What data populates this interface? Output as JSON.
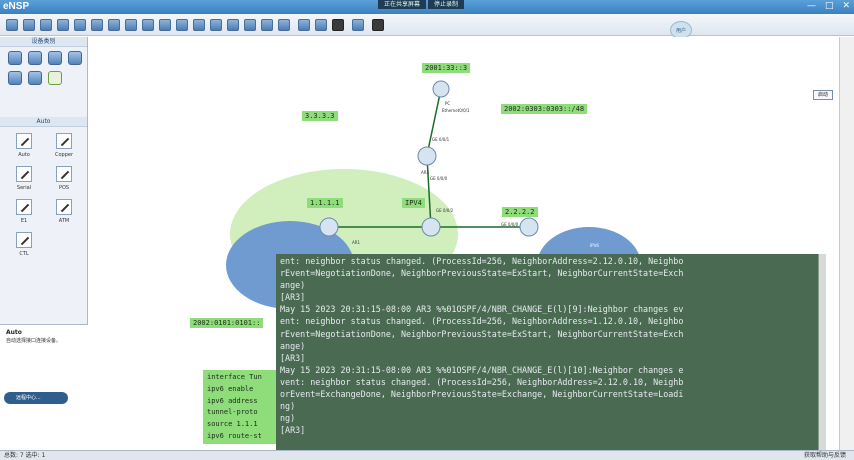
{
  "app": {
    "title": "eNSP",
    "window_controls": [
      "—",
      "□",
      "✕"
    ]
  },
  "recorder": {
    "items": [
      "正在共享屏幕",
      "停止录制"
    ]
  },
  "toolbar": {
    "user_label": "用户"
  },
  "left_panel": {
    "device_header": "设备类别",
    "cable_header": "Auto",
    "cables": [
      "Auto",
      "Copper",
      "Serial",
      "POS",
      "E1",
      "ATM",
      "CTL"
    ],
    "desc_title": "Auto",
    "desc_text": "自动选择接口连接设备。",
    "desc_button": "远程中心..."
  },
  "canvas": {
    "right_button": "启动",
    "labels": {
      "ipv6_top": "2001:33::3",
      "ipv6_right": "2002:0303:0303::/48",
      "addr_333": "3.3.3.3",
      "addr_111": "1.1.1.1",
      "ipv4_area": "IPV4",
      "addr_222": "2.2.2.2",
      "ipv6_left": "2002:0101:0101::"
    },
    "tiny_labels": {
      "pc_name": "PC",
      "pc_port": "Ethernet0/0/1",
      "ge_1": "GE 0/0/1",
      "ar3": "AR3",
      "ge_2": "GE 0/0/0",
      "ge_3": "GE 0/0/2",
      "ge_4": "GE 0/0/0",
      "ar1": "AR1",
      "ipv6_r": "IPV6"
    },
    "config_box": [
      "interface Tun",
      "ipv6 enable",
      "ipv6 address",
      "tunnel-proto",
      "source 1.1.1",
      "ipv6 route-st"
    ]
  },
  "terminal": {
    "lines": [
      "ent: neighbor status changed. (ProcessId=256, NeighborAddress=2.12.0.10, Neighbo",
      "rEvent=NegotiationDone, NeighborPreviousState=ExStart, NeighborCurrentState=Exch",
      "ange)",
      "[AR3]",
      "May 15 2023 20:31:15-08:00 AR3 %%01OSPF/4/NBR_CHANGE_E(l)[9]:Neighbor changes ev",
      "ent: neighbor status changed. (ProcessId=256, NeighborAddress=1.12.0.10, Neighbo",
      "rEvent=NegotiationDone, NeighborPreviousState=ExStart, NeighborCurrentState=Exch",
      "ange)",
      "[AR3]",
      "May 15 2023 20:31:15-08:00 AR3 %%01OSPF/4/NBR_CHANGE_E(l)[10]:Neighbor changes e",
      "vent: neighbor status changed. (ProcessId=256, NeighborAddress=2.12.0.10, Neighb",
      "orEvent=ExchangeDone, NeighborPreviousState=Exchange, NeighborCurrentState=Loadi",
      "ng)",
      "ng)",
      "[AR3]"
    ]
  },
  "statusbar": {
    "left": "总数: 7  选中: 1",
    "right": "获取帮助与反馈"
  },
  "colors": {
    "titlebar": "#3b7fc0",
    "label_green": "#8fdc7b",
    "terminal_bg": "#4a6a52",
    "ospf_area": "#c8ecb0",
    "ipv6_area": "#6f9bd1"
  }
}
